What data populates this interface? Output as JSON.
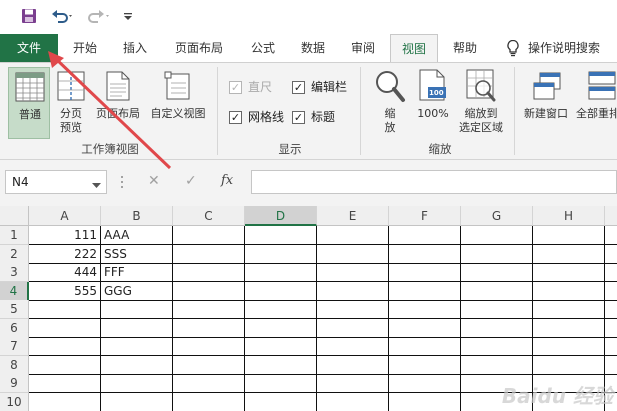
{
  "quick_access": {
    "icons": [
      "save-icon",
      "undo-icon",
      "redo-icon",
      "customize-qat-icon"
    ]
  },
  "tabs": [
    {
      "label": "文件"
    },
    {
      "label": "开始"
    },
    {
      "label": "插入"
    },
    {
      "label": "页面布局"
    },
    {
      "label": "公式"
    },
    {
      "label": "数据"
    },
    {
      "label": "审阅"
    },
    {
      "label": "视图"
    },
    {
      "label": "帮助"
    }
  ],
  "tell_me": {
    "label": "操作说明搜索"
  },
  "ribbon": {
    "workbook_views": {
      "normal": "普通",
      "page_break_1": "分页",
      "page_break_2": "预览",
      "page_layout": "页面布局",
      "custom_views": "自定义视图",
      "group_label": "工作簿视图"
    },
    "show": {
      "ruler": "直尺",
      "formula_bar": "编辑栏",
      "gridlines": "网格线",
      "headings": "标题",
      "group_label": "显示",
      "check_mark": "✓"
    },
    "zoom": {
      "zoom_1": "缩",
      "zoom_2": "放",
      "zoom_100": "100%",
      "zoom_selection_1": "缩放到",
      "zoom_selection_2": "选定区域",
      "zoom_icon_text": "100",
      "group_label": "缩放"
    },
    "window": {
      "new_window": "新建窗口",
      "arrange_all": "全部重排"
    }
  },
  "formula_bar": {
    "name_box": "N4",
    "cancel_glyph": "✕",
    "enter_glyph": "✓",
    "fx": "fx",
    "value": ""
  },
  "sheet": {
    "columns": [
      "A",
      "B",
      "C",
      "D",
      "E",
      "F",
      "G",
      "H"
    ],
    "selected_column": "D",
    "selected_row": "4",
    "rows": [
      {
        "num": "1",
        "a": "111",
        "b": "AAA"
      },
      {
        "num": "2",
        "a": "222",
        "b": "SSS"
      },
      {
        "num": "3",
        "a": "444",
        "b": "FFF"
      },
      {
        "num": "4",
        "a": "555",
        "b": "GGG"
      },
      {
        "num": "5",
        "a": "",
        "b": ""
      },
      {
        "num": "6",
        "a": "",
        "b": ""
      },
      {
        "num": "7",
        "a": "",
        "b": ""
      },
      {
        "num": "8",
        "a": "",
        "b": ""
      },
      {
        "num": "9",
        "a": "",
        "b": ""
      },
      {
        "num": "10",
        "a": "",
        "b": ""
      }
    ]
  },
  "watermark": "Baidu 经验",
  "colors": {
    "accent": "#217346",
    "arrow": "#e0484b"
  }
}
